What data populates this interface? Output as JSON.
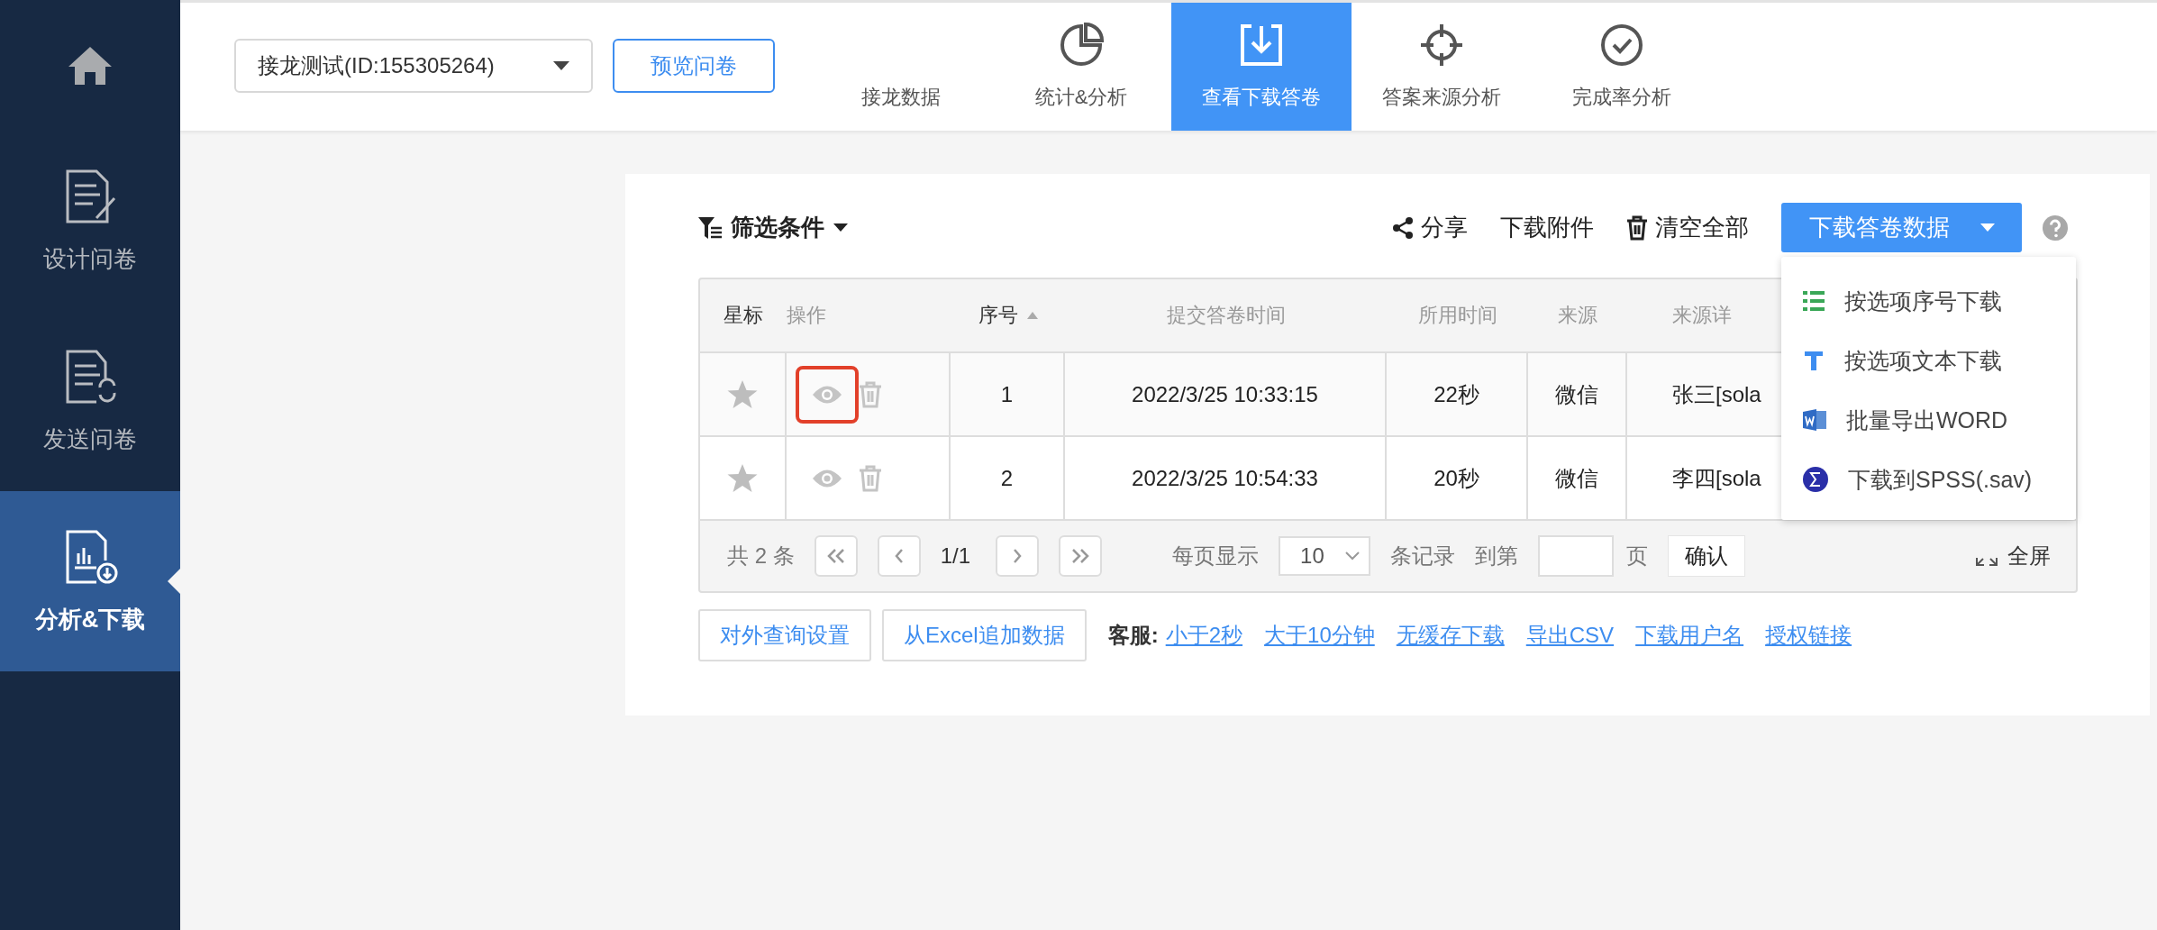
{
  "sidebar": {
    "items": [
      {
        "label": "设计问卷",
        "kind": "design",
        "selected": false
      },
      {
        "label": "发送问卷",
        "kind": "send",
        "selected": false
      },
      {
        "label": "分析&下载",
        "kind": "analyze",
        "selected": true
      }
    ]
  },
  "header": {
    "survey_select": {
      "value": "接龙测试(ID:155305264)"
    },
    "preview_button": "预览问卷",
    "tabs": [
      {
        "label": "接龙数据",
        "kind": "none",
        "selected": false
      },
      {
        "label": "统计&分析",
        "kind": "pie",
        "selected": false
      },
      {
        "label": "查看下载答卷",
        "kind": "download",
        "selected": true
      },
      {
        "label": "答案来源分析",
        "kind": "target",
        "selected": false
      },
      {
        "label": "完成率分析",
        "kind": "check",
        "selected": false
      }
    ]
  },
  "toolbar": {
    "filter": "筛选条件",
    "share": "分享",
    "download_attachments": "下载附件",
    "clear_all": "清空全部",
    "download_data": "下载答卷数据"
  },
  "download_menu": [
    {
      "label": "按选项序号下载",
      "kind": "list"
    },
    {
      "label": "按选项文本下载",
      "kind": "text"
    },
    {
      "label": "批量导出WORD",
      "kind": "word"
    },
    {
      "label": "下载到SPSS(.sav)",
      "kind": "sigma"
    }
  ],
  "table": {
    "columns": [
      {
        "label": "星标",
        "kind": "star"
      },
      {
        "label": "操作",
        "kind": "plain"
      },
      {
        "label": "序号",
        "kind": "sort"
      },
      {
        "label": "提交答卷时间",
        "kind": "plain"
      },
      {
        "label": "所用时间",
        "kind": "plain"
      },
      {
        "label": "来源",
        "kind": "plain"
      },
      {
        "label": "来源详",
        "kind": "plain"
      }
    ],
    "rows": [
      {
        "starred": false,
        "highlighted": true,
        "index": "1",
        "submitted": "2022/3/25 10:33:15",
        "duration": "22秒",
        "source": "微信",
        "source_detail": "张三[sola"
      },
      {
        "starred": false,
        "highlighted": false,
        "index": "2",
        "submitted": "2022/3/25 10:54:33",
        "duration": "20秒",
        "source": "微信",
        "source_detail": "李四[sola"
      }
    ]
  },
  "pager": {
    "total": "共 2 条",
    "page": "1/1",
    "per_page_label": "每页显示",
    "per_page": "10",
    "records_label": "条记录",
    "goto_label": "到第",
    "page_unit": "页",
    "confirm": "确认",
    "fullscreen": "全屏"
  },
  "footer": {
    "buttons": [
      "对外查询设置",
      "从Excel追加数据"
    ],
    "service_label": "客服:",
    "links": [
      "小于2秒",
      "大于10分钟",
      "无缓存下载",
      "导出CSV",
      "下载用户名",
      "授权链接"
    ]
  }
}
